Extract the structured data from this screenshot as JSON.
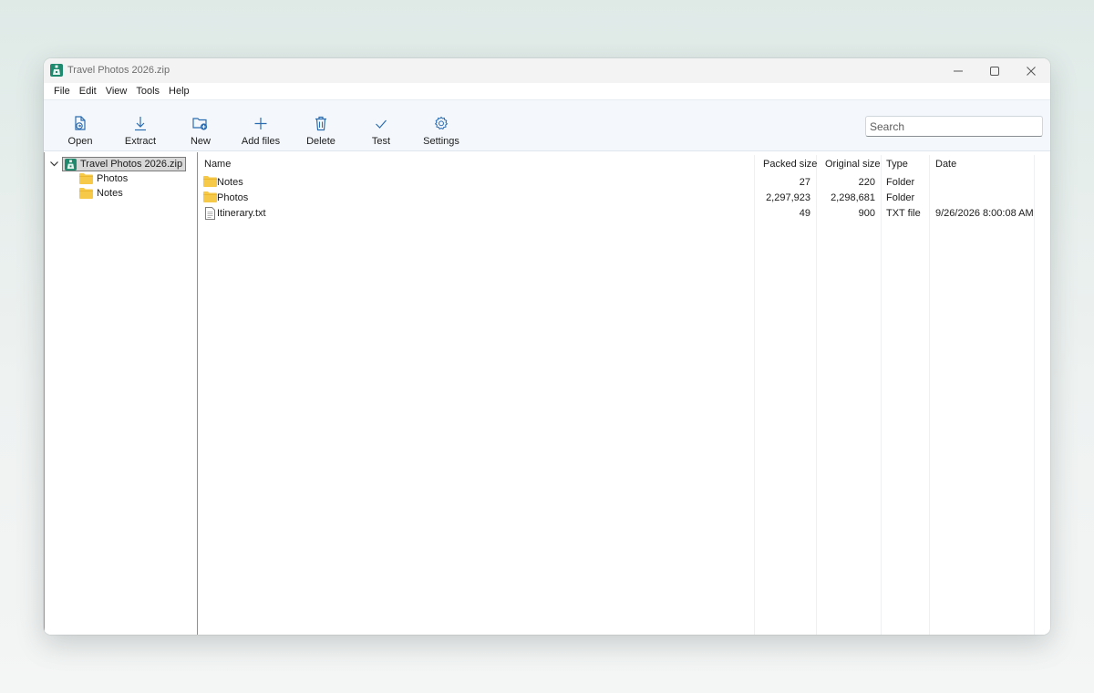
{
  "window": {
    "title": "Travel Photos 2026.zip"
  },
  "menu": [
    "File",
    "Edit",
    "View",
    "Tools",
    "Help"
  ],
  "toolbar": {
    "open": "Open",
    "extract": "Extract",
    "new": "New",
    "add_files": "Add files",
    "delete": "Delete",
    "test": "Test",
    "settings": "Settings",
    "search_placeholder": "Search"
  },
  "tree": {
    "root": "Travel Photos 2026.zip",
    "children": [
      "Photos",
      "Notes"
    ]
  },
  "list": {
    "headers": {
      "name": "Name",
      "packed": "Packed size",
      "original": "Original size",
      "type": "Type",
      "date": "Date"
    },
    "rows": [
      {
        "name": "Notes",
        "packed": "27",
        "original": "220",
        "type": "Folder",
        "date": "",
        "icon": "folder-icon"
      },
      {
        "name": "Photos",
        "packed": "2,297,923",
        "original": "2,298,681",
        "type": "Folder",
        "date": "",
        "icon": "folder-icon"
      },
      {
        "name": "Itinerary.txt",
        "packed": "49",
        "original": "900",
        "type": "TXT file",
        "date": "9/26/2026 8:00:08 AM",
        "icon": "text-file-icon"
      }
    ]
  },
  "colors": {
    "accent": "#2b6cb0",
    "app_icon": "#1f8a6e",
    "folder": "#f7c948",
    "toolbar_bg": "#f4f8fc"
  }
}
